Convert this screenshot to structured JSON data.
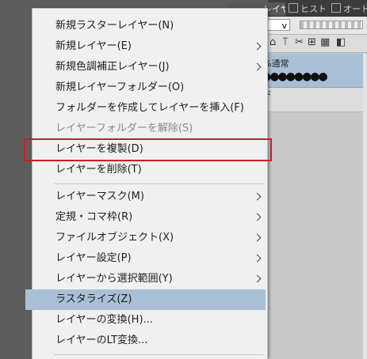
{
  "panel": {
    "tabs": [
      {
        "label": "レイヤー"
      },
      {
        "label": "ヒストリー"
      },
      {
        "label": "オートアクション"
      }
    ],
    "blend_value": "v",
    "layer_mode_label": "%通常",
    "layer_dots": "●●●●●●●●",
    "layer_2_label": "ド"
  },
  "menu": {
    "items": [
      {
        "label": "新規ラスターレイヤー(N)",
        "submenu": false,
        "enabled": true
      },
      {
        "label": "新規レイヤー(E)",
        "submenu": true,
        "enabled": true
      },
      {
        "label": "新規色調補正レイヤー(J)",
        "submenu": true,
        "enabled": true
      },
      {
        "label": "新規レイヤーフォルダー(O)",
        "submenu": false,
        "enabled": true
      },
      {
        "label": "フォルダーを作成してレイヤーを挿入(F)",
        "submenu": false,
        "enabled": true
      },
      {
        "label": "レイヤーフォルダーを解除(S)",
        "submenu": false,
        "enabled": false
      },
      {
        "label": "レイヤーを複製(D)",
        "submenu": false,
        "enabled": true,
        "highlighted": true
      },
      {
        "label": "レイヤーを削除(T)",
        "submenu": false,
        "enabled": true
      },
      {
        "label": "レイヤーマスク(M)",
        "submenu": true,
        "enabled": true
      },
      {
        "label": "定規・コマ枠(R)",
        "submenu": true,
        "enabled": true
      },
      {
        "label": "ファイルオブジェクト(X)",
        "submenu": true,
        "enabled": true
      },
      {
        "label": "レイヤー設定(P)",
        "submenu": true,
        "enabled": true
      },
      {
        "label": "レイヤーから選択範囲(Y)",
        "submenu": true,
        "enabled": true
      },
      {
        "label": "ラスタライズ(Z)",
        "submenu": false,
        "enabled": true,
        "hovered": true
      },
      {
        "label": "レイヤーの変換(H)...",
        "submenu": false,
        "enabled": true
      },
      {
        "label": "レイヤーのLT変換...",
        "submenu": false,
        "enabled": true
      }
    ]
  },
  "colors": {
    "menu_background": "#f0f0f0",
    "hover_background": "#a9bfd5",
    "highlight_border": "#cc1f1f",
    "disabled_text": "#8a8a8a"
  }
}
